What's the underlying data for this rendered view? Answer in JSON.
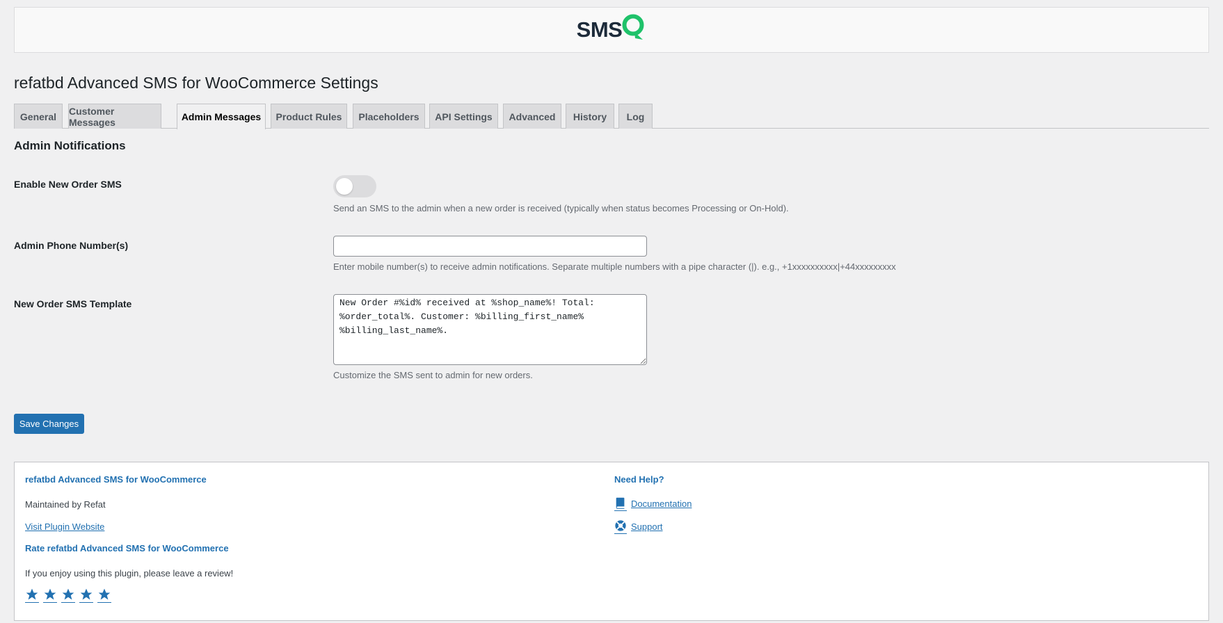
{
  "logo": {
    "brand_text": "SMS",
    "mark": "Q"
  },
  "page_title": "refatbd Advanced SMS for WooCommerce Settings",
  "tabs": [
    {
      "label": "General",
      "active": false
    },
    {
      "label": "Customer Messages",
      "active": false
    },
    {
      "label": "Admin Messages",
      "active": true
    },
    {
      "label": "Product Rules",
      "active": false
    },
    {
      "label": "Placeholders",
      "active": false
    },
    {
      "label": "API Settings",
      "active": false
    },
    {
      "label": "Advanced",
      "active": false
    },
    {
      "label": "History",
      "active": false
    },
    {
      "label": "Log",
      "active": false
    }
  ],
  "section": {
    "title": "Admin Notifications",
    "enable_new_order": {
      "label": "Enable New Order SMS",
      "enabled": false,
      "description": "Send an SMS to the admin when a new order is received (typically when status becomes Processing or On-Hold)."
    },
    "admin_phone": {
      "label": "Admin Phone Number(s)",
      "value": "",
      "description": "Enter mobile number(s) to receive admin notifications. Separate multiple numbers with a pipe character (|). e.g., +1xxxxxxxxxx|+44xxxxxxxxx"
    },
    "new_order_template": {
      "label": "New Order SMS Template",
      "value": "New Order #%id% received at %shop_name%! Total: %order_total%. Customer: %billing_first_name% %billing_last_name%.",
      "description": "Customize the SMS sent to admin for new orders."
    }
  },
  "save_button": "Save Changes",
  "footer": {
    "plugin_title": "refatbd Advanced SMS for WooCommerce",
    "maintained_by": "Maintained by Refat",
    "visit_link": "Visit Plugin Website",
    "rate_title": "Rate refatbd Advanced SMS for WooCommerce",
    "rate_text": "If you enjoy using this plugin, please leave a review!",
    "stars": 5,
    "help_title": "Need Help?",
    "documentation": "Documentation",
    "support": "Support"
  },
  "colors": {
    "accent": "#2271b1",
    "brand_dark": "#1d2b3a",
    "brand_green": "#1fc26a"
  }
}
